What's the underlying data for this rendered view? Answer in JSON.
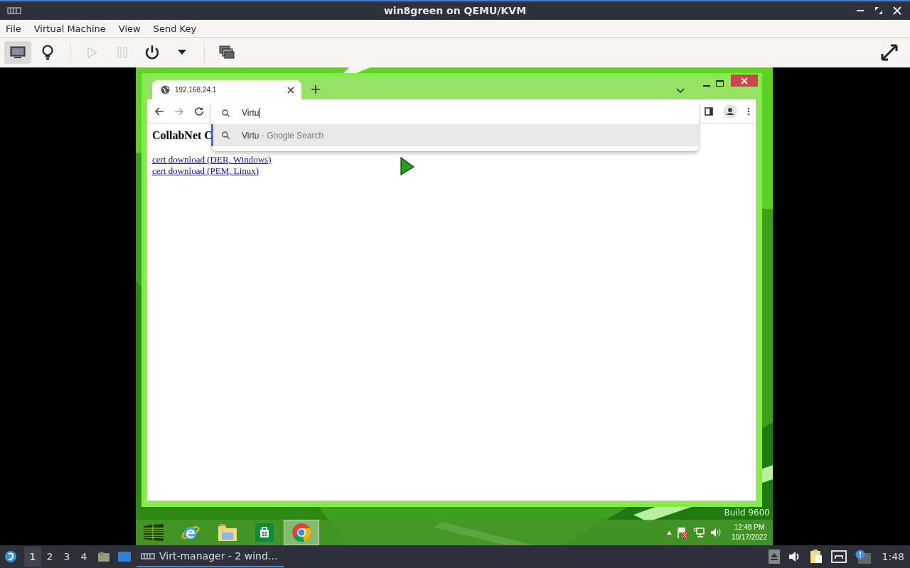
{
  "window": {
    "title": "win8green on QEMU/KVM"
  },
  "menu": [
    "File",
    "Virtual Machine",
    "View",
    "Send Key"
  ],
  "toolbar": [
    {
      "kind": "console",
      "selected": true,
      "disabled": false
    },
    {
      "kind": "details",
      "selected": false,
      "disabled": false
    },
    {
      "kind": "run",
      "selected": false,
      "disabled": true
    },
    {
      "kind": "pause",
      "selected": false,
      "disabled": true
    },
    {
      "kind": "power",
      "selected": false,
      "disabled": false
    },
    {
      "kind": "caret",
      "selected": false,
      "disabled": false
    },
    {
      "kind": "snapshots",
      "selected": false,
      "disabled": false
    },
    {
      "kind": "fullscreen",
      "selected": false,
      "disabled": false
    }
  ],
  "guest": {
    "browser": {
      "tab": {
        "title": "192.168.24.1"
      },
      "omnibox": {
        "value": "Virtu"
      },
      "suggestions": [
        {
          "query": "Virtu",
          "hint": "- Google Search",
          "selected": true
        }
      ],
      "page": {
        "heading": "CollabNet C",
        "links": [
          "cert download (DER, Windows)",
          "cert download (PEM, Linux)"
        ]
      }
    },
    "wallpaper_text": "Build 9600",
    "taskbar": {
      "apps": [
        {
          "kind": "start",
          "selected": false
        },
        {
          "kind": "ie",
          "selected": false
        },
        {
          "kind": "explorer",
          "selected": false
        },
        {
          "kind": "store",
          "selected": false
        },
        {
          "kind": "chrome",
          "selected": true
        }
      ],
      "clock": {
        "time": "12:48 PM",
        "date": "10/17/2022"
      }
    }
  },
  "host_taskbar": {
    "workspaces": [
      {
        "label": "1",
        "selected": true
      },
      {
        "label": "2",
        "selected": false
      },
      {
        "label": "3",
        "selected": false
      },
      {
        "label": "4",
        "selected": false
      }
    ],
    "tasks": [
      {
        "label": "Virt-manager - 2 wind…",
        "selected": true
      }
    ],
    "clock": "1:48"
  }
}
